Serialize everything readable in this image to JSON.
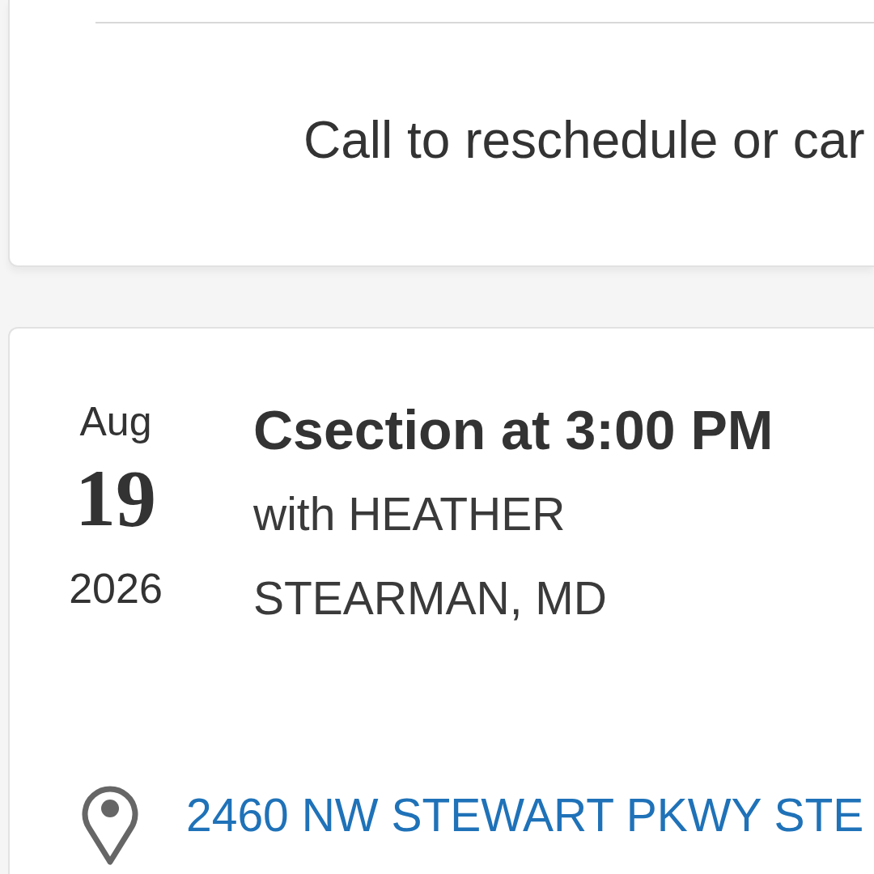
{
  "cards": [
    {
      "kind": "notice",
      "message": "Call to reschedule or car"
    },
    {
      "kind": "appointment",
      "date": {
        "month": "Aug",
        "day": "19",
        "year": "2026"
      },
      "title": "Csection at 3:00 PM",
      "provider": "with HEATHER STEARMAN, MD",
      "address": "2460 NW STEWART PKWY STE"
    }
  ]
}
